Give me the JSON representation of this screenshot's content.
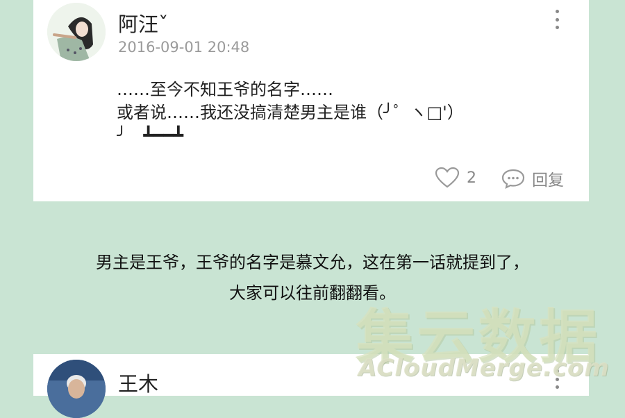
{
  "post": {
    "username": "阿汪ˇ",
    "timestamp": "2016-09-01 20:48",
    "comment_lines": [
      "……至今不知王爷的名字……",
      "或者说……我还没搞清楚男主是谁（╯゜ヽ□'）",
      "╯︵┻━━┻"
    ],
    "likes": "2",
    "reply_label": "回复"
  },
  "caption": {
    "line1": "男主是王爷，王爷的名字是慕文允，这在第一话就提到了，",
    "line2": "大家可以往前翻翻看。"
  },
  "next_post": {
    "username": "王木"
  },
  "watermark": {
    "cn": "集云数据",
    "en": "ACloudMerge.com"
  },
  "icons": {
    "more": "more-vertical-icon",
    "like": "heart-icon",
    "reply": "comment-bubble-icon"
  },
  "colors": {
    "background": "#c9e4d3",
    "card": "#ffffff",
    "muted_text": "#9a9a9a"
  }
}
